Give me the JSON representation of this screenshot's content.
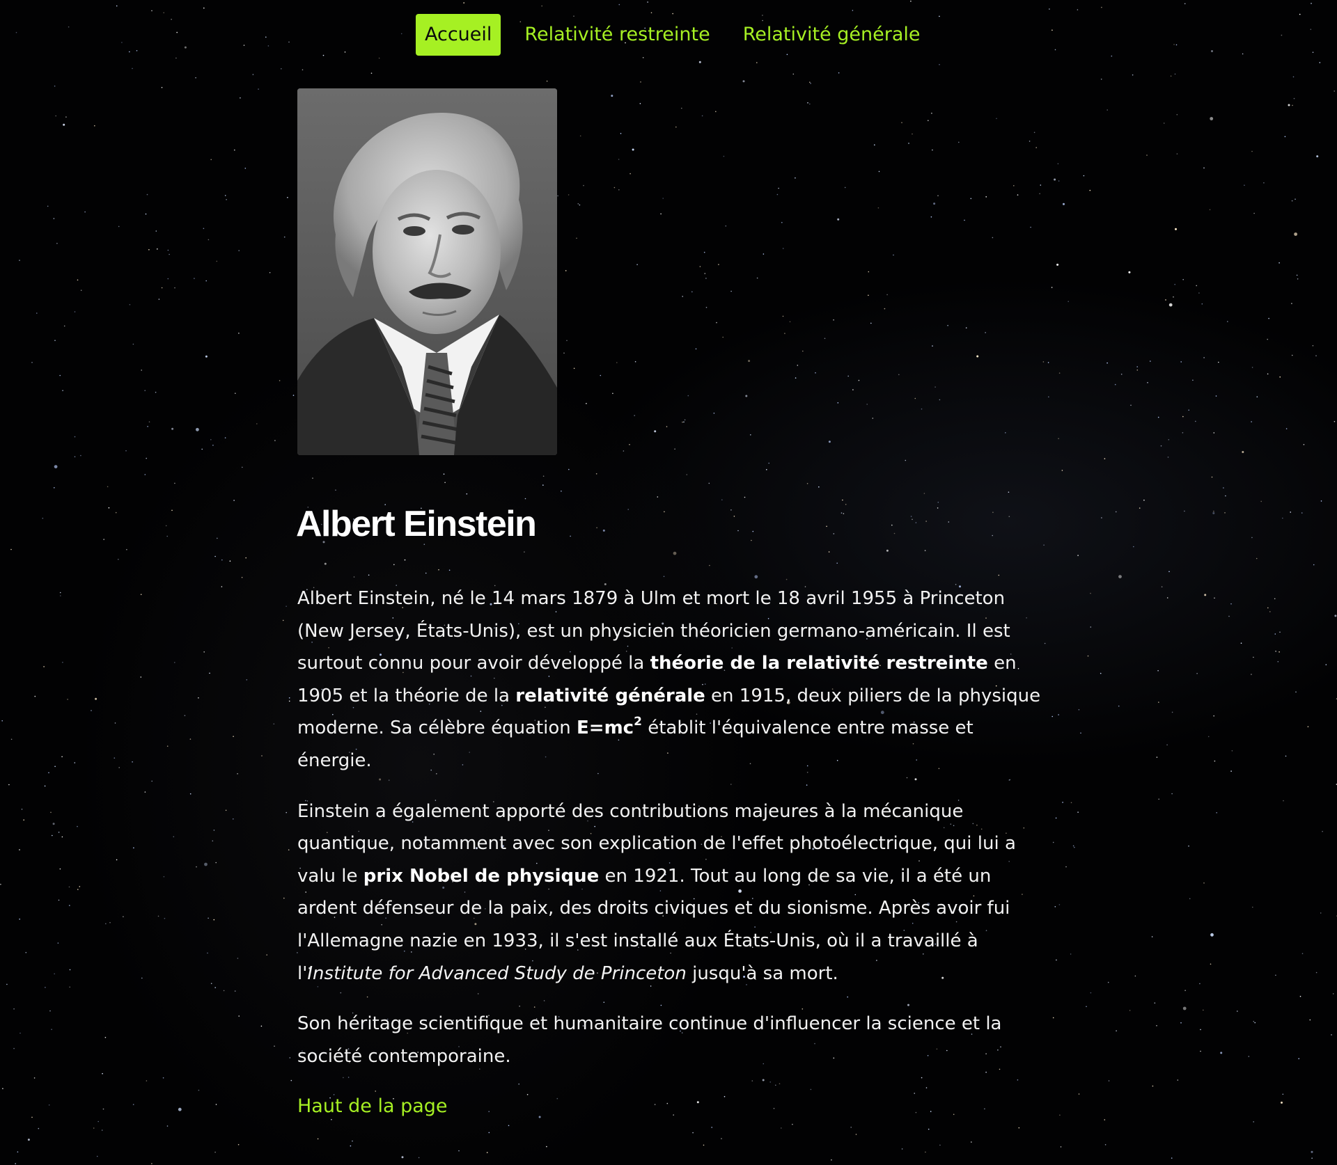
{
  "nav": {
    "items": [
      {
        "label": "Accueil",
        "active": true
      },
      {
        "label": "Relativité restreinte",
        "active": false
      },
      {
        "label": "Relativité générale",
        "active": false
      }
    ]
  },
  "colors": {
    "accent": "#a6f023",
    "background": "#000000",
    "text": "#f2f2f2"
  },
  "portrait": {
    "image": "black-and-white portrait photograph"
  },
  "page_title": "Albert Einstein",
  "paragraphs": {
    "p1": {
      "t1": "Albert Einstein, né le 14 mars 1879 à Ulm et mort le 18 avril 1955 à Princeton (New Jersey, États-Unis), est un physicien théoricien germano-américain. Il est surtout connu pour avoir développé la ",
      "b1": "théorie de la relativité restreinte",
      "t2": " en 1905 et la théorie de la ",
      "b2": "relativité générale",
      "t3": " en 1915, deux piliers de la physique moderne. Sa célèbre équation ",
      "eq": "E=mc",
      "eq_sup": "2",
      "t4": " établit l'équivalence entre masse et énergie."
    },
    "p2": {
      "t1": "Einstein a également apporté des contributions majeures à la mécanique quantique, notamment avec son explication de l'effet photoélectrique, qui lui a valu le ",
      "b1": "prix Nobel de physique",
      "t2": " en 1921. Tout au long de sa vie, il a été un ardent défenseur de la paix, des droits civiques et du sionisme. Après avoir fui l'Allemagne nazie en 1933, il s'est installé aux États-Unis, où il a travaillé à l'",
      "i1": "Institute for Advanced Study de Princeton",
      "t3": " jusqu'à sa mort."
    },
    "p3": {
      "t1": "Son héritage scientifique et humanitaire continue d'influencer la science et la société contemporaine."
    }
  },
  "back_to_top": "Haut de la page"
}
